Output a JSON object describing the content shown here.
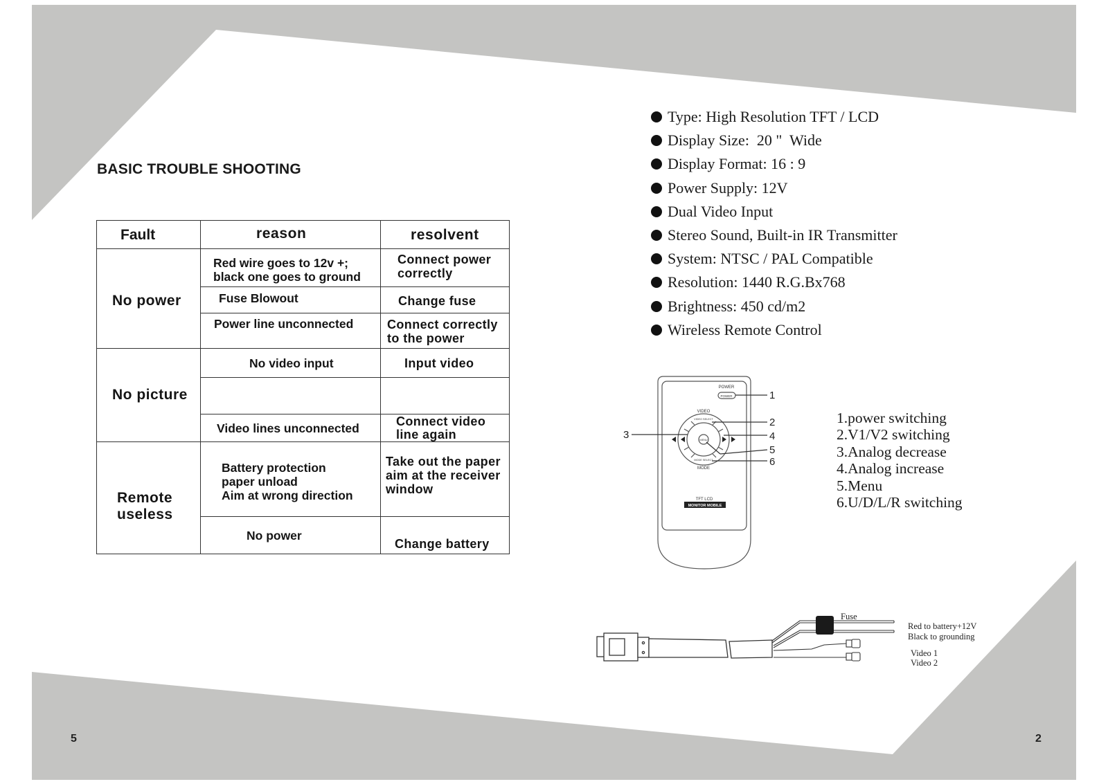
{
  "page_left": {
    "title": "BASIC TROUBLE SHOOTING",
    "page_number": "5",
    "table": {
      "headers": [
        "Fault",
        "reason",
        "resolvent"
      ],
      "groups": [
        {
          "fault": "No power",
          "rows": [
            {
              "reason": "Red wire goes to  12v +;\nblack one goes to ground",
              "resolvent": "Connect power\ncorrectly"
            },
            {
              "reason": "Fuse Blowout",
              "resolvent": "Change  fuse"
            },
            {
              "reason": "Power line unconnected",
              "resolvent": "Connect correctly\nto the power"
            }
          ]
        },
        {
          "fault": "No picture",
          "rows": [
            {
              "reason": "No video input",
              "resolvent": "Input video"
            },
            {
              "reason": "",
              "resolvent": ""
            },
            {
              "reason": "Video lines unconnected",
              "resolvent": "Connect video\nline again"
            }
          ]
        },
        {
          "fault": "Remote\nuseless",
          "rows": [
            {
              "reason": "Battery protection\npaper unload\nAim at wrong direction",
              "resolvent": "Take out the paper\naim at the receiver\nwindow"
            },
            {
              "reason": "No power",
              "resolvent": "Change battery"
            }
          ]
        }
      ]
    }
  },
  "page_right": {
    "page_number": "2",
    "specs": [
      "Type: High Resolution TFT / LCD",
      "Display Size:  20 \"  Wide",
      "Display Format: 16 : 9",
      "Power Supply: 12V",
      "Dual Video Input",
      "Stereo Sound, Built-in IR Transmitter",
      "System: NTSC / PAL Compatible",
      "Resolution: 1440 R.G.Bx768",
      "Brightness: 450 cd/m2",
      "Wireless Remote Control"
    ],
    "remote": {
      "power_label": "POWER",
      "power_button": "POWER",
      "video_label": "VIDEO",
      "video_select": "VIDEO SELECT",
      "menu_label": "MENU",
      "mode_select": "MODE SELECT",
      "mode_label": "MODE",
      "brand_line1": "TFT LCD",
      "brand_line2": "MONITOR MOBILE",
      "callouts": [
        "1",
        "2",
        "3",
        "4",
        "5",
        "6"
      ]
    },
    "legend": [
      "1.power switching",
      "2.V1/V2 switching",
      "3.Analog decrease",
      "4.Analog increase",
      "5.Menu",
      "6.U/D/L/R switching"
    ],
    "cable": {
      "fuse_label": "Fuse",
      "red_label": "Red to battery+12V",
      "black_label": "Black to grounding",
      "video1_label": "Video 1",
      "video2_label": "Video 2"
    }
  },
  "colors": {
    "background_gray": "#c4c4c2",
    "paper": "#ffffff",
    "ink": "#151515"
  }
}
